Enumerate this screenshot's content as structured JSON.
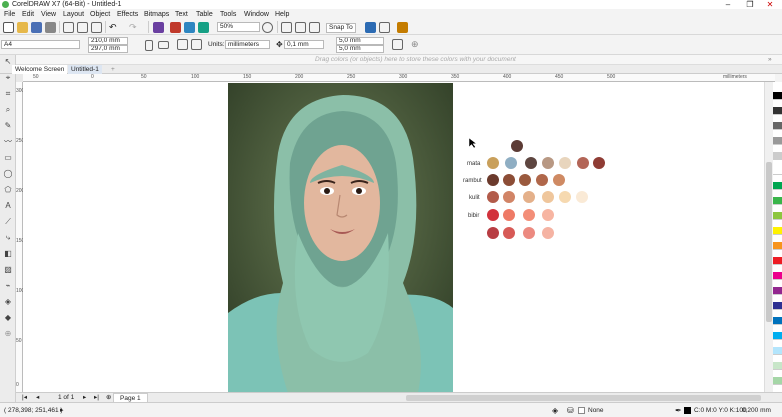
{
  "window": {
    "title": "CorelDRAW X7 (64-Bit) - Untitled-1",
    "controls": [
      "minimize",
      "restore",
      "close"
    ]
  },
  "menu": [
    "File",
    "Edit",
    "View",
    "Layout",
    "Object",
    "Effects",
    "Bitmaps",
    "Text",
    "Table",
    "Tools",
    "Window",
    "Help"
  ],
  "standard_toolbar": {
    "zoom_value": "50%",
    "snap_to_label": "Snap To"
  },
  "property_bar": {
    "page_size": "A4",
    "width": "210,0 mm",
    "height": "297,0 mm",
    "units_label": "Units:",
    "units_value": "millimeters",
    "nudge": "0,1 mm",
    "dup_x": "5,0 mm",
    "dup_y": "5,0 mm"
  },
  "hint_text": "Drag colors (or objects) here to store these colors with your document",
  "tabs": [
    "Welcome Screen",
    "Untitled-1"
  ],
  "ruler": {
    "unit_label": "millimeters",
    "h_ticks": [
      "50",
      "0",
      "50",
      "100",
      "150",
      "200",
      "250",
      "300",
      "350",
      "400",
      "450",
      "500"
    ],
    "v_ticks": [
      "300",
      "250",
      "200",
      "150",
      "100",
      "50",
      "0"
    ]
  },
  "swatch_rows": [
    {
      "label": "",
      "colors": [
        "#5c3b35"
      ]
    },
    {
      "label": "mata",
      "colors": [
        "#c9a05b",
        "#8faec3",
        "#5e4640",
        "#b89883",
        "#e8d5bd",
        "#b36557",
        "#8f3c34"
      ]
    },
    {
      "label": "rambut",
      "colors": [
        "#6b3a2c",
        "#8c4d36",
        "#9a5a3e",
        "#b0674a",
        "#cf8a63"
      ]
    },
    {
      "label": "kulit",
      "colors": [
        "#b25b4a",
        "#d18466",
        "#e4b08a",
        "#efc69c",
        "#f6d9b0",
        "#faead6"
      ]
    },
    {
      "label": "bibir",
      "colors": [
        "#d2323c",
        "#ee7a66",
        "#f38e78",
        "#f7b5a2"
      ]
    },
    {
      "label": "",
      "colors": [
        "#b83d43",
        "#d75a56",
        "#ec8a80",
        "#f5b3a3"
      ]
    }
  ],
  "color_palette": [
    "#000000",
    "#333333",
    "#666666",
    "#999999",
    "#cccccc",
    "#ffffff",
    "#00a651",
    "#39b54a",
    "#8dc63f",
    "#fff200",
    "#f7941d",
    "#ed1c24",
    "#ec008c",
    "#92278f",
    "#2e3192",
    "#0072bc",
    "#00aeef",
    "#b3e5fc",
    "#c8e6c9",
    "#a5d6a7"
  ],
  "page_nav": {
    "counter": "1 of 1",
    "page_tab": "Page 1"
  },
  "status": {
    "coordinates": "( 278,398; 251,461 )",
    "fill": "None",
    "outline_color": "C:0 M:0 Y:0 K:100",
    "outline_width": "0,200 mm"
  }
}
